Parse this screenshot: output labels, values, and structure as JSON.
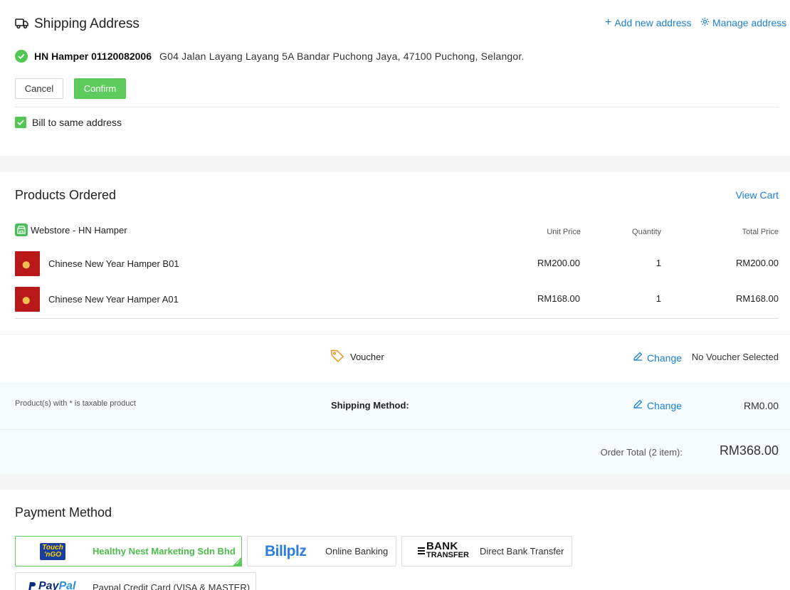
{
  "shipping": {
    "title": "Shipping Address",
    "add_new": "Add new address",
    "manage": "Manage address",
    "name_phone": "HN Hamper 01120082006",
    "address": "G04 Jalan Layang Layang 5A Bandar Puchong Jaya, 47100 Puchong, Selangor.",
    "cancel_label": "Cancel",
    "confirm_label": "Confirm",
    "bill_same": "Bill to same address",
    "bill_same_checked": true
  },
  "products": {
    "title": "Products Ordered",
    "view_cart": "View Cart",
    "store_name": "Webstore - HN Hamper",
    "col_unit": "Unit Price",
    "col_qty": "Quantity",
    "col_total": "Total Price",
    "items": [
      {
        "name": "Chinese New Year Hamper B01",
        "unit_price": "RM200.00",
        "quantity": "1",
        "total_price": "RM200.00"
      },
      {
        "name": "Chinese New Year Hamper A01",
        "unit_price": "RM168.00",
        "quantity": "1",
        "total_price": "RM168.00"
      }
    ]
  },
  "voucher": {
    "label": "Voucher",
    "change": "Change",
    "value": "No Voucher Selected"
  },
  "shipping_method": {
    "tax_note": "Product(s) with * is taxable product",
    "label": "Shipping Method:",
    "change": "Change",
    "fee": "RM0.00"
  },
  "order_total": {
    "label": "Order Total (2 item):",
    "value": "RM368.00"
  },
  "payment": {
    "title": "Payment Method",
    "options": [
      {
        "logo": "Touch 'n GO",
        "label": "Healthy Nest Marketing Sdn Bhd",
        "selected": true
      },
      {
        "logo": "Billplz",
        "label": "Online Banking",
        "selected": false
      },
      {
        "logo": "BANK TRANSFER",
        "label": "Direct Bank Transfer",
        "selected": false
      },
      {
        "logo": "PayPal",
        "label": "Paypal Credit Card (VISA & MASTER)",
        "selected": false
      }
    ]
  },
  "colors": {
    "accent_green": "#5dcc5d",
    "link_blue": "#1b7fd6",
    "voucher_orange": "#f0961e"
  },
  "icons": {
    "truck": "truck-icon",
    "plus": "plus-icon",
    "gear": "gear-icon",
    "check": "check-circle-icon",
    "store": "store-icon",
    "tag": "tag-icon",
    "pencil": "pencil-icon"
  }
}
